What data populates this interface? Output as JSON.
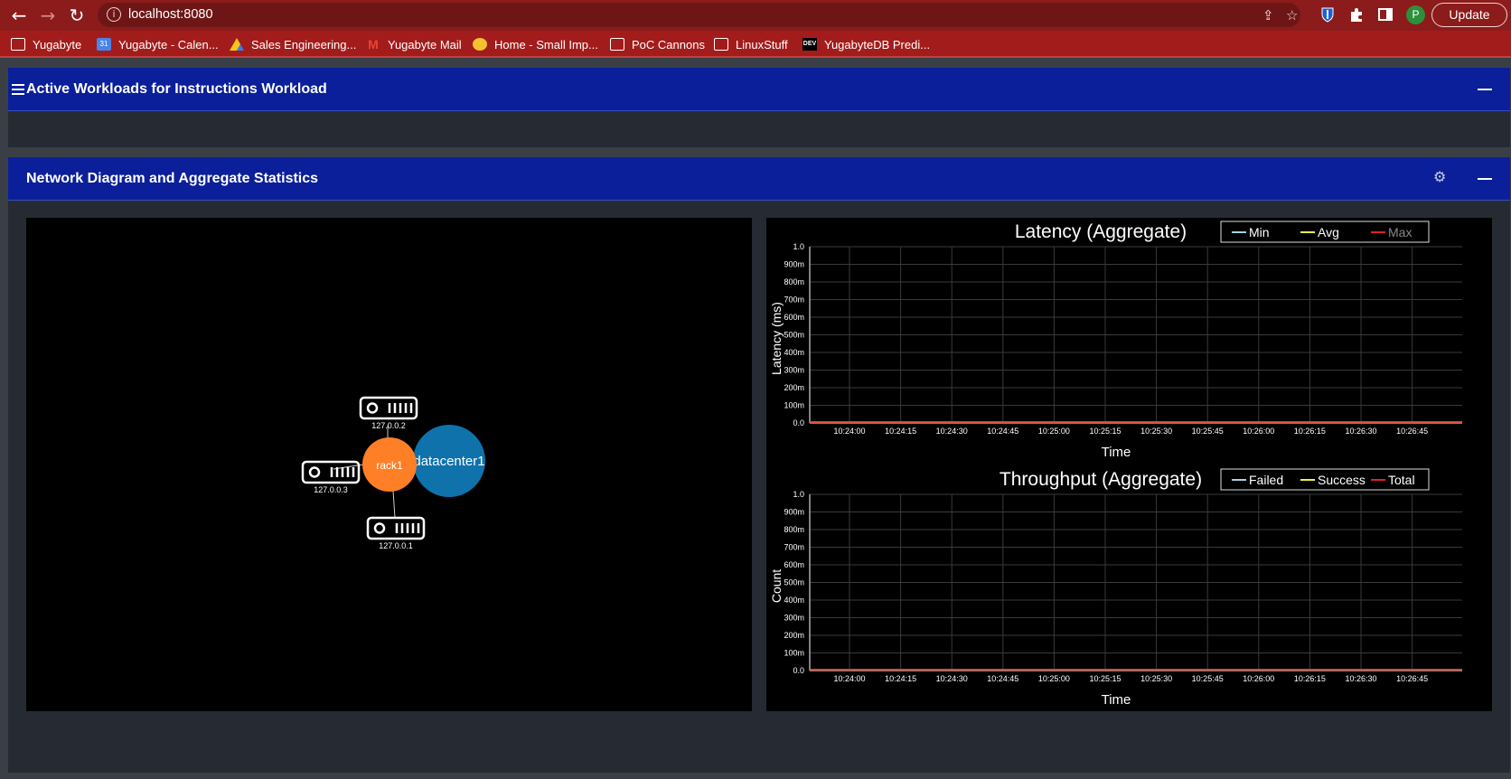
{
  "browser": {
    "url": "localhost:8080",
    "update_label": "Update",
    "avatar_initial": "P"
  },
  "bookmarks": [
    {
      "label": "Yugabyte",
      "icon": "folder-icon"
    },
    {
      "label": "Yugabyte - Calen...",
      "icon": "calendar-icon"
    },
    {
      "label": "Sales Engineering...",
      "icon": "drive-icon"
    },
    {
      "label": "Yugabyte Mail",
      "icon": "gmail-icon"
    },
    {
      "label": "Home - Small Imp...",
      "icon": "home-site-icon"
    },
    {
      "label": "PoC Cannons",
      "icon": "folder-icon"
    },
    {
      "label": "LinuxStuff",
      "icon": "folder-icon"
    },
    {
      "label": "YugabyteDB Predi...",
      "icon": "dev-icon"
    }
  ],
  "panels": {
    "active_workloads": {
      "title": "Active Workloads for Instructions Workload"
    },
    "network": {
      "title": "Network Diagram and Aggregate Statistics"
    }
  },
  "diagram": {
    "datacenter": "datacenter1",
    "rack": "rack1",
    "nodes": [
      "127.0.0.2",
      "127.0.0.3",
      "127.0.0.1"
    ],
    "colors": {
      "rack": "#ff7f27",
      "datacenter": "#0f72ab"
    }
  },
  "chart_data": [
    {
      "type": "line",
      "title": "Latency (Aggregate)",
      "xlabel": "Time",
      "ylabel": "Latency (ms)",
      "yticks": [
        "0.0",
        "100m",
        "200m",
        "300m",
        "400m",
        "500m",
        "600m",
        "700m",
        "800m",
        "900m",
        "1.0"
      ],
      "ylim": [
        0,
        1
      ],
      "x_ticks": [
        "10:24:00",
        "10:24:15",
        "10:24:30",
        "10:24:45",
        "10:25:00",
        "10:25:15",
        "10:25:30",
        "10:25:45",
        "10:26:00",
        "10:26:15",
        "10:26:30",
        "10:26:45"
      ],
      "legend_position": "top-right",
      "grid": true,
      "series": [
        {
          "name": "Min",
          "color": "#9fd3e6",
          "values": [
            0,
            0,
            0,
            0,
            0,
            0,
            0,
            0,
            0,
            0,
            0,
            0
          ]
        },
        {
          "name": "Avg",
          "color": "#f2f23c",
          "values": [
            0,
            0,
            0,
            0,
            0,
            0,
            0,
            0,
            0,
            0,
            0,
            0
          ]
        },
        {
          "name": "Max",
          "color": "#e02020",
          "values": [
            0,
            0,
            0,
            0,
            0,
            0,
            0,
            0,
            0,
            0,
            0,
            0
          ]
        }
      ]
    },
    {
      "type": "line",
      "title": "Throughput (Aggregate)",
      "xlabel": "Time",
      "ylabel": "Count",
      "yticks": [
        "0.0",
        "100m",
        "200m",
        "300m",
        "400m",
        "500m",
        "600m",
        "700m",
        "800m",
        "900m",
        "1.0"
      ],
      "ylim": [
        0,
        1
      ],
      "x_ticks": [
        "10:24:00",
        "10:24:15",
        "10:24:30",
        "10:24:45",
        "10:25:00",
        "10:25:15",
        "10:25:30",
        "10:25:45",
        "10:26:00",
        "10:26:15",
        "10:26:30",
        "10:26:45"
      ],
      "legend_position": "top-right",
      "grid": true,
      "series": [
        {
          "name": "Failed",
          "color": "#9fd3e6",
          "values": [
            0,
            0,
            0,
            0,
            0,
            0,
            0,
            0,
            0,
            0,
            0,
            0
          ]
        },
        {
          "name": "Success",
          "color": "#f2f23c",
          "values": [
            0,
            0,
            0,
            0,
            0,
            0,
            0,
            0,
            0,
            0,
            0,
            0
          ]
        },
        {
          "name": "Total",
          "color": "#e02020",
          "values": [
            0,
            0,
            0,
            0,
            0,
            0,
            0,
            0,
            0,
            0,
            0,
            0
          ]
        }
      ]
    }
  ]
}
